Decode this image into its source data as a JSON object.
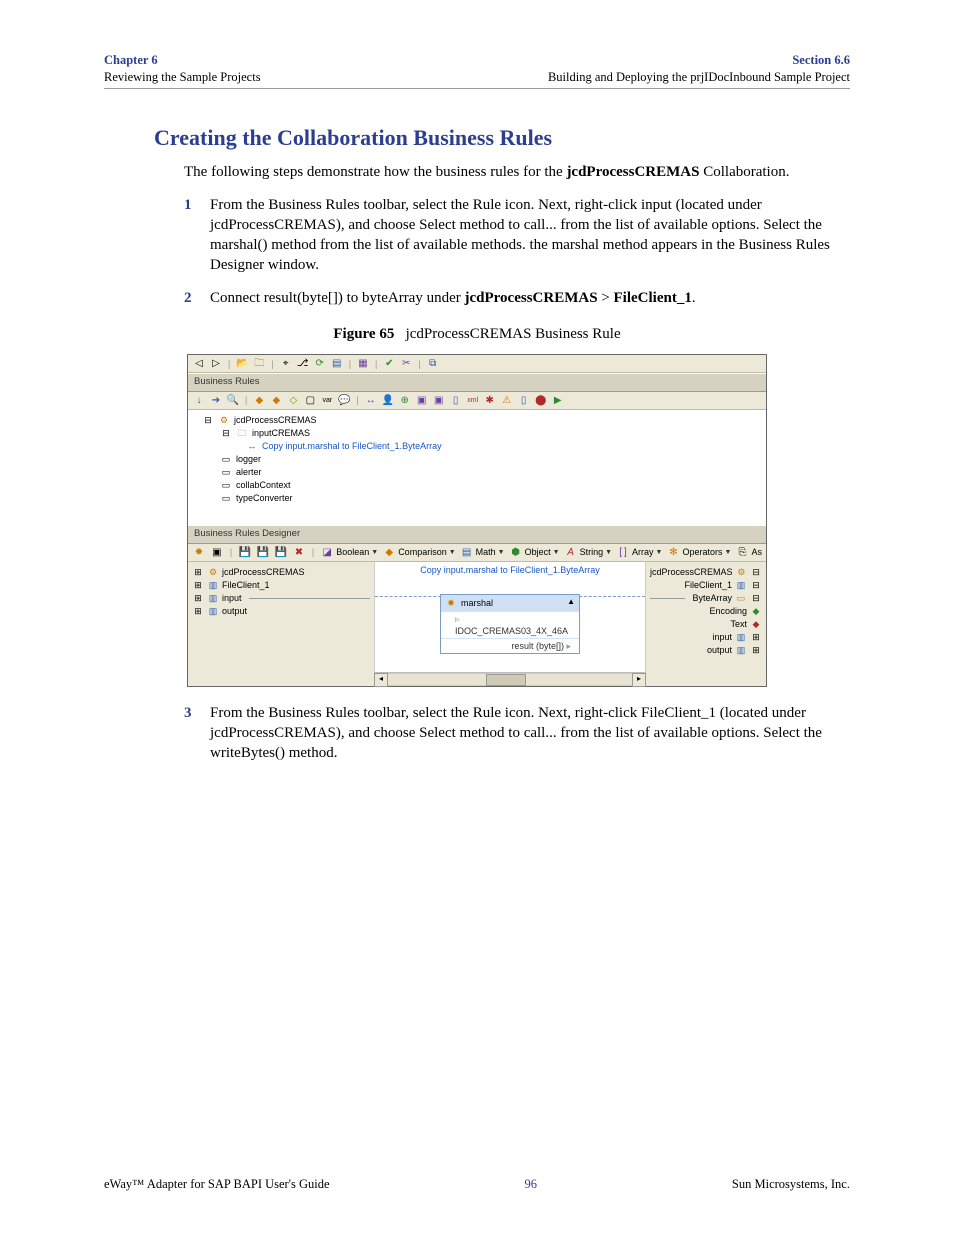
{
  "header": {
    "chapter_label": "Chapter 6",
    "chapter_sub": "Reviewing the Sample Projects",
    "section_label": "Section 6.6",
    "section_sub": "Building and Deploying the prjIDocInbound Sample Project"
  },
  "title": "Creating the Collaboration Business Rules",
  "intro_pre": "The following steps demonstrate how the business rules for the ",
  "intro_bold": "jcdProcessCREMAS",
  "intro_post": " Collaboration.",
  "steps": {
    "s1": {
      "num": "1",
      "text": "From the Business Rules toolbar, select the Rule icon. Next, right-click input (located under jcdProcessCREMAS), and choose Select method to call... from the list of available options. Select the marshal() method from the list of available methods. the marshal method appears in the Business Rules Designer window."
    },
    "s2": {
      "num": "2",
      "pre": "Connect result(byte[]) to byteArray under ",
      "bold1": "jcdProcessCREMAS",
      "mid": " > ",
      "bold2": "FileClient_1",
      "post": "."
    },
    "s3": {
      "num": "3",
      "text": "From the Business Rules toolbar, select the Rule icon. Next, right-click FileClient_1 (located under jcdProcessCREMAS), and choose Select method to call... from the list of available options. Select the writeBytes() method."
    }
  },
  "figure": {
    "label": "Figure 65",
    "caption": "jcdProcessCREMAS Business Rule"
  },
  "app": {
    "panel_rules": "Business Rules",
    "panel_designer": "Business Rules Designer",
    "tree": {
      "n0": "jcdProcessCREMAS",
      "n1": "inputCREMAS",
      "n2": "Copy input.marshal to FileClient_1.ByteArray",
      "n3": "logger",
      "n4": "alerter",
      "n5": "collabContext",
      "n6": "typeConverter"
    },
    "designer_menus": {
      "m1": "Boolean",
      "m2": "Comparison",
      "m3": "Math",
      "m4": "Object",
      "m5": "String",
      "m6": "Array",
      "m7": "Operators",
      "m8": "As"
    },
    "canvas_title": "Copy input.marshal to FileClient_1.ByteArray",
    "left_tree": {
      "l0": "jcdProcessCREMAS",
      "l1": "FileClient_1",
      "l2": "input",
      "l3": "output"
    },
    "right_tree": {
      "r0": "jcdProcessCREMAS",
      "r1": "FileClient_1",
      "r2": "ByteArray",
      "r3": "Encoding",
      "r4": "Text",
      "r5": "input",
      "r6": "output"
    },
    "node": {
      "title": "marshal",
      "row1": "IDOC_CREMAS03_4X_46A",
      "row2": "result (byte[])"
    }
  },
  "footer": {
    "left": "eWay™ Adapter for SAP BAPI User's Guide",
    "page": "96",
    "right": "Sun Microsystems, Inc."
  }
}
